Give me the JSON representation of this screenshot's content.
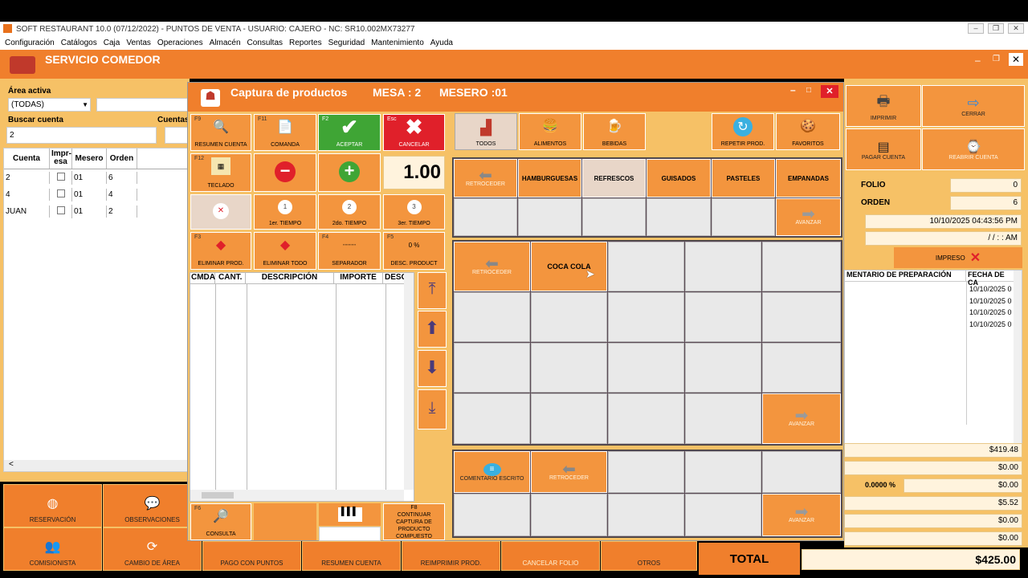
{
  "app": {
    "title": "SOFT RESTAURANT  10.0 (07/12/2022)  -  PUNTOS DE VENTA  -  USUARIO: CAJERO    -    NC: SR10.002MX73277",
    "menu": [
      "Configuración",
      "Catálogos",
      "Caja",
      "Ventas",
      "Operaciones",
      "Almacén",
      "Consultas",
      "Reportes",
      "Seguridad",
      "Mantenimiento",
      "Ayuda"
    ],
    "window_title": "SERVICIO COMEDOR"
  },
  "left": {
    "area_label": "Área activa",
    "area_value": "(TODAS)",
    "buscar_label": "Buscar cuenta",
    "buscar_value": "2",
    "cuentas_label": "Cuentas",
    "columns": [
      "Cuenta",
      "Impresa",
      "Mesero",
      "Orden"
    ],
    "col_impresa_top": "Impr-",
    "col_impresa_bottom": "esa",
    "rows": [
      {
        "cuenta": "2",
        "mesero": "01",
        "orden": "6"
      },
      {
        "cuenta": "4",
        "mesero": "01",
        "orden": "4"
      },
      {
        "cuenta": "JUAN",
        "mesero": "01",
        "orden": "2"
      }
    ],
    "scroll_left": "<"
  },
  "dialog": {
    "title": "Captura de productos",
    "mesa": "MESA : 2",
    "mesero": "MESERO :01",
    "keys": {
      "resumen": {
        "fkey": "F9",
        "label": "RESUMEN CUENTA"
      },
      "comanda": {
        "fkey": "F11",
        "label": "COMANDA"
      },
      "aceptar": {
        "fkey": "F2",
        "label": "ACEPTAR"
      },
      "cancelar": {
        "fkey": "Esc",
        "label": "CANCELAR"
      },
      "teclado": {
        "fkey": "F12",
        "label": "TECLADO"
      },
      "qty": "1.00",
      "t1": "1er. TIEMPO",
      "t2": "2do. TIEMPO",
      "t3": "3er. TIEMPO",
      "t1n": "1",
      "t2n": "2",
      "t3n": "3",
      "elim": {
        "fkey": "F3",
        "label": "ELIMINAR PROD."
      },
      "elimtodo": {
        "label": "ELIMINAR TODO"
      },
      "sep": {
        "fkey": "F4",
        "label": "SEPARADOR"
      },
      "desc": {
        "fkey": "F5",
        "pct": "0 %",
        "label": "DESC. PRODUCT"
      }
    },
    "table_columns": [
      "CMDA",
      "CANT.",
      "DESCRIPCIÓN",
      "IMPORTE",
      "DESC"
    ],
    "bottom": {
      "consulta": {
        "fkey": "F6",
        "label": "CONSULTA"
      },
      "continuar": {
        "fkey": "F8",
        "label": "CONTINUAR CAPTURA DE PRODUCTO COMPUESTO"
      }
    },
    "groups": [
      {
        "label": "TODOS",
        "icon": "chair-icon"
      },
      {
        "label": "ALIMENTOS",
        "icon": "burger-icon"
      },
      {
        "label": "BEBIDAS",
        "icon": "beer-icon"
      }
    ],
    "repetir": "REPETIR PROD.",
    "favoritos": "FAVORITOS",
    "subgroups": [
      "HAMBURGUESAS",
      "REFRESCOS",
      "GUISADOS",
      "PASTELES",
      "EMPANADAS"
    ],
    "retroceder": "RETROCEDER",
    "avanzar": "AVANZAR",
    "products": [
      "COCA COLA"
    ],
    "comentario": "COMENTARIO ESCRITO"
  },
  "right": {
    "imprimir": "IMPRIMIR",
    "cerrar": "CERRAR",
    "pagar": "PAGAR CUENTA",
    "reabrir": "REABRIR CUENTA",
    "folio_label": "FOLIO",
    "folio": "0",
    "orden_label": "ORDEN",
    "orden": "6",
    "fecha": "10/10/2025 04:43:56 PM",
    "fecha2": "/ /     : : AM",
    "impreso": "IMPRESO",
    "col1": "MENTARIO DE PREPARACIÓN",
    "col2": "FECHA DE CA",
    "dates": [
      "10/10/2025 0",
      "10/10/2025 0",
      "10/10/2025 0",
      "10/10/2025 0"
    ],
    "amounts": [
      "$419.48",
      "$0.00",
      "$0.00",
      "$5.52",
      "$0.00",
      "$0.00"
    ],
    "pct": "0.0000 %",
    "total_label": "TOTAL",
    "total": "$425.00"
  },
  "bottom": {
    "row1": [
      "RESERVACIÓN",
      "OBSERVACIONES"
    ],
    "row2": [
      "COMISIONISTA",
      "CAMBIO DE ÁREA",
      "PAGO CON PUNTOS",
      "RESUMEN CUENTA",
      "REIMPRIMIR PROD.",
      "CANCELAR FOLIO",
      "OTROS"
    ]
  },
  "colors": {
    "accent": "#f07f2c",
    "panel": "#f6c166",
    "tile": "#f3953e",
    "ok": "#3fa535",
    "cancel": "#e0202a"
  }
}
